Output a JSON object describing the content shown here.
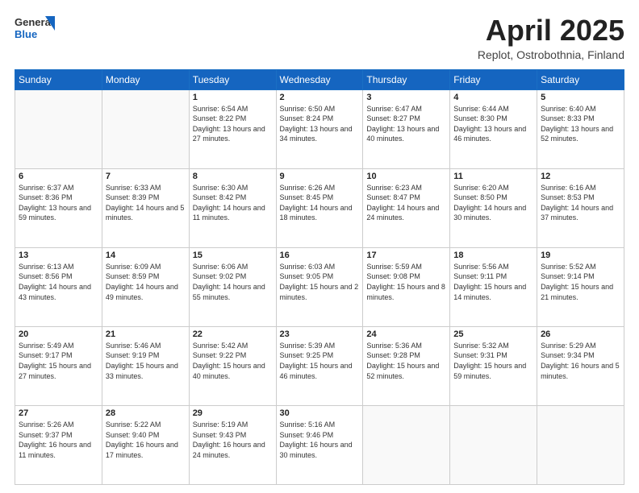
{
  "header": {
    "logo_general": "General",
    "logo_blue": "Blue",
    "title": "April 2025",
    "location": "Replot, Ostrobothnia, Finland"
  },
  "weekdays": [
    "Sunday",
    "Monday",
    "Tuesday",
    "Wednesday",
    "Thursday",
    "Friday",
    "Saturday"
  ],
  "weeks": [
    [
      {
        "day": "",
        "info": ""
      },
      {
        "day": "",
        "info": ""
      },
      {
        "day": "1",
        "info": "Sunrise: 6:54 AM\nSunset: 8:22 PM\nDaylight: 13 hours and 27 minutes."
      },
      {
        "day": "2",
        "info": "Sunrise: 6:50 AM\nSunset: 8:24 PM\nDaylight: 13 hours and 34 minutes."
      },
      {
        "day": "3",
        "info": "Sunrise: 6:47 AM\nSunset: 8:27 PM\nDaylight: 13 hours and 40 minutes."
      },
      {
        "day": "4",
        "info": "Sunrise: 6:44 AM\nSunset: 8:30 PM\nDaylight: 13 hours and 46 minutes."
      },
      {
        "day": "5",
        "info": "Sunrise: 6:40 AM\nSunset: 8:33 PM\nDaylight: 13 hours and 52 minutes."
      }
    ],
    [
      {
        "day": "6",
        "info": "Sunrise: 6:37 AM\nSunset: 8:36 PM\nDaylight: 13 hours and 59 minutes."
      },
      {
        "day": "7",
        "info": "Sunrise: 6:33 AM\nSunset: 8:39 PM\nDaylight: 14 hours and 5 minutes."
      },
      {
        "day": "8",
        "info": "Sunrise: 6:30 AM\nSunset: 8:42 PM\nDaylight: 14 hours and 11 minutes."
      },
      {
        "day": "9",
        "info": "Sunrise: 6:26 AM\nSunset: 8:45 PM\nDaylight: 14 hours and 18 minutes."
      },
      {
        "day": "10",
        "info": "Sunrise: 6:23 AM\nSunset: 8:47 PM\nDaylight: 14 hours and 24 minutes."
      },
      {
        "day": "11",
        "info": "Sunrise: 6:20 AM\nSunset: 8:50 PM\nDaylight: 14 hours and 30 minutes."
      },
      {
        "day": "12",
        "info": "Sunrise: 6:16 AM\nSunset: 8:53 PM\nDaylight: 14 hours and 37 minutes."
      }
    ],
    [
      {
        "day": "13",
        "info": "Sunrise: 6:13 AM\nSunset: 8:56 PM\nDaylight: 14 hours and 43 minutes."
      },
      {
        "day": "14",
        "info": "Sunrise: 6:09 AM\nSunset: 8:59 PM\nDaylight: 14 hours and 49 minutes."
      },
      {
        "day": "15",
        "info": "Sunrise: 6:06 AM\nSunset: 9:02 PM\nDaylight: 14 hours and 55 minutes."
      },
      {
        "day": "16",
        "info": "Sunrise: 6:03 AM\nSunset: 9:05 PM\nDaylight: 15 hours and 2 minutes."
      },
      {
        "day": "17",
        "info": "Sunrise: 5:59 AM\nSunset: 9:08 PM\nDaylight: 15 hours and 8 minutes."
      },
      {
        "day": "18",
        "info": "Sunrise: 5:56 AM\nSunset: 9:11 PM\nDaylight: 15 hours and 14 minutes."
      },
      {
        "day": "19",
        "info": "Sunrise: 5:52 AM\nSunset: 9:14 PM\nDaylight: 15 hours and 21 minutes."
      }
    ],
    [
      {
        "day": "20",
        "info": "Sunrise: 5:49 AM\nSunset: 9:17 PM\nDaylight: 15 hours and 27 minutes."
      },
      {
        "day": "21",
        "info": "Sunrise: 5:46 AM\nSunset: 9:19 PM\nDaylight: 15 hours and 33 minutes."
      },
      {
        "day": "22",
        "info": "Sunrise: 5:42 AM\nSunset: 9:22 PM\nDaylight: 15 hours and 40 minutes."
      },
      {
        "day": "23",
        "info": "Sunrise: 5:39 AM\nSunset: 9:25 PM\nDaylight: 15 hours and 46 minutes."
      },
      {
        "day": "24",
        "info": "Sunrise: 5:36 AM\nSunset: 9:28 PM\nDaylight: 15 hours and 52 minutes."
      },
      {
        "day": "25",
        "info": "Sunrise: 5:32 AM\nSunset: 9:31 PM\nDaylight: 15 hours and 59 minutes."
      },
      {
        "day": "26",
        "info": "Sunrise: 5:29 AM\nSunset: 9:34 PM\nDaylight: 16 hours and 5 minutes."
      }
    ],
    [
      {
        "day": "27",
        "info": "Sunrise: 5:26 AM\nSunset: 9:37 PM\nDaylight: 16 hours and 11 minutes."
      },
      {
        "day": "28",
        "info": "Sunrise: 5:22 AM\nSunset: 9:40 PM\nDaylight: 16 hours and 17 minutes."
      },
      {
        "day": "29",
        "info": "Sunrise: 5:19 AM\nSunset: 9:43 PM\nDaylight: 16 hours and 24 minutes."
      },
      {
        "day": "30",
        "info": "Sunrise: 5:16 AM\nSunset: 9:46 PM\nDaylight: 16 hours and 30 minutes."
      },
      {
        "day": "",
        "info": ""
      },
      {
        "day": "",
        "info": ""
      },
      {
        "day": "",
        "info": ""
      }
    ]
  ]
}
